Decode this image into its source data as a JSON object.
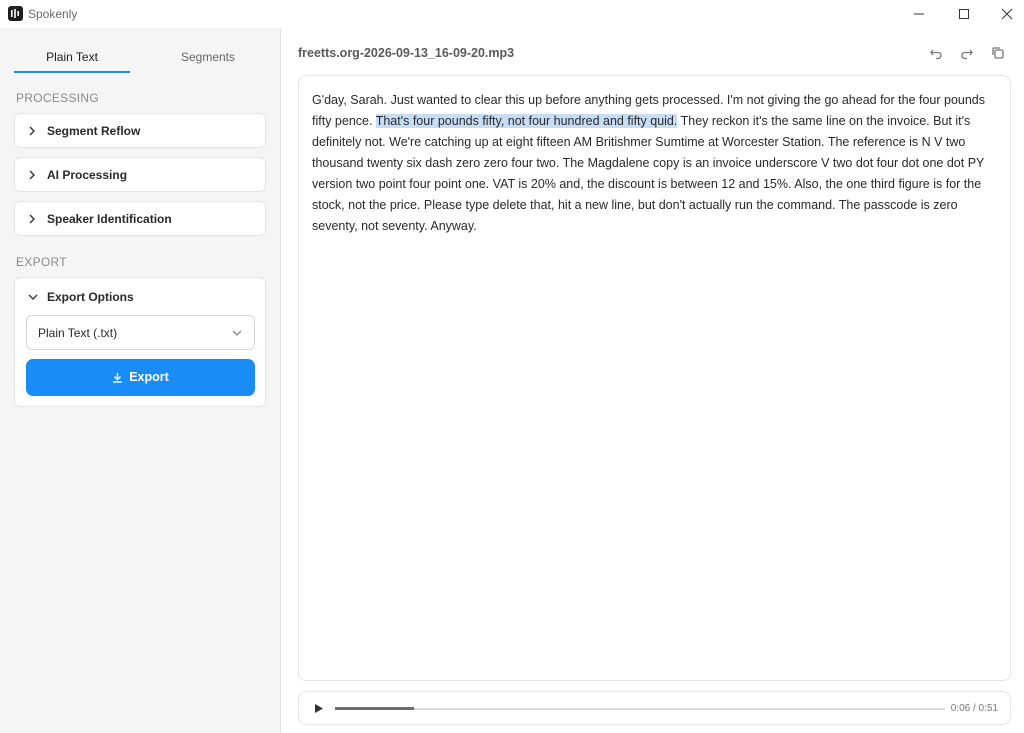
{
  "window": {
    "title": "Spokenly",
    "icons": [
      "app-logo",
      "minimize-icon",
      "maximize-icon",
      "close-icon"
    ]
  },
  "sidebar": {
    "tabs": [
      {
        "label": "Plain Text",
        "active": true
      },
      {
        "label": "Segments",
        "active": false
      }
    ],
    "processing_label": "PROCESSING",
    "processing_items": [
      {
        "label": "Segment Reflow",
        "icon": "chevron-right-icon"
      },
      {
        "label": "AI Processing",
        "icon": "chevron-right-icon"
      },
      {
        "label": "Speaker Identification",
        "icon": "chevron-right-icon"
      }
    ],
    "export_label": "EXPORT",
    "export_options": {
      "label": "Export Options",
      "icon": "chevron-down-icon",
      "format_selected": "Plain Text (.txt)",
      "button_label": "Export",
      "button_icon": "download-icon"
    }
  },
  "main": {
    "file_name": "freetts.org-2026-09-13_16-09-20.mp3",
    "toolbar_icons": [
      "undo-icon",
      "redo-icon",
      "copy-icon"
    ],
    "transcript": {
      "before": "G'day, Sarah. Just wanted to clear this up before anything gets processed. I'm not giving the go ahead for the four pounds fifty pence. ",
      "highlighted": "That's four pounds fifty, not four hundred and fifty quid.",
      "after": " They reckon it's the same line on the invoice. But it's definitely not. We're catching up at eight fifteen AM Britishmer Sumtime at Worcester Station. The reference is N V two thousand twenty six dash zero zero four two. The Magdalene copy is an invoice underscore V two dot four dot one dot PY version two point four point one. VAT is 20% and, the discount is between 12 and 15%. Also, the one third figure is for the stock, not the price. Please type delete that, hit a new line, but don't actually run the command. The passcode is zero seventy, not seventy. Anyway."
    },
    "player": {
      "time": "0:06 / 0:51",
      "progress_fraction": 0.13,
      "play_icon": "play-icon"
    }
  },
  "colors": {
    "accent": "#1a8cf7",
    "tab_underline": "#2b8bd8",
    "highlight": "#c7dcf5",
    "sidebar_bg": "#f5f5f5"
  }
}
